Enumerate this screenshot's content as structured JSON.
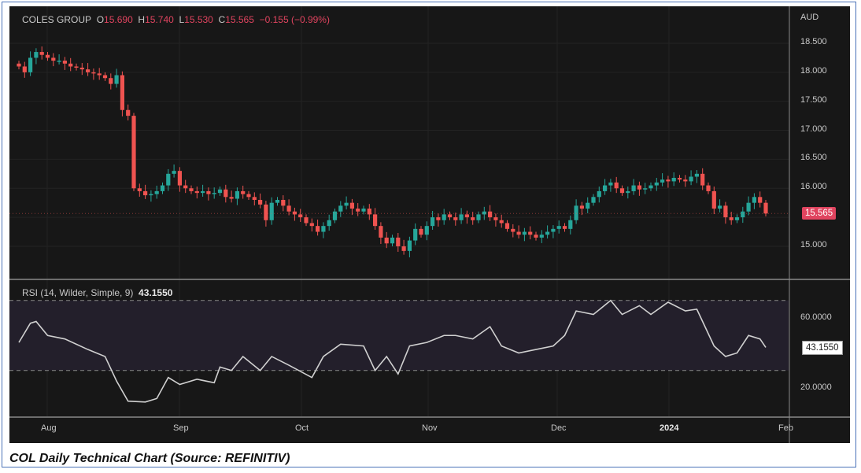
{
  "legend": {
    "name": "COLES GROUP",
    "o_label": "O",
    "o": "15.690",
    "h_label": "H",
    "h": "15.740",
    "l_label": "L",
    "l": "15.530",
    "c_label": "C",
    "c": "15.565",
    "change": "−0.155 (−0.99%)"
  },
  "rsi_legend": {
    "label": "RSI (14, Wilder, Simple, 9)",
    "value": "43.1550"
  },
  "price_axis": {
    "currency": "AUD",
    "ticks": [
      "18.500",
      "18.000",
      "17.500",
      "17.000",
      "16.500",
      "16.000",
      "15.000"
    ],
    "last_price": "15.565"
  },
  "rsi_axis": {
    "ticks": [
      "60.0000",
      "20.0000"
    ],
    "last_value": "43.1550"
  },
  "time_axis": [
    "Aug",
    "Sep",
    "Oct",
    "Nov",
    "Dec",
    "2024",
    "Feb"
  ],
  "caption": "COL Daily Technical Chart (Source: REFINITIV)",
  "colors": {
    "up": "#26a69a",
    "down": "#ef5350",
    "rsi_line": "#d0d0d0",
    "rsi_band": "#231f2b"
  },
  "chart_data": {
    "type": "candlestick",
    "title": "COLES GROUP",
    "ylabel": "AUD",
    "ylim": [
      14.6,
      18.8
    ],
    "open_first": 18.15,
    "closes": [
      18.1,
      18.0,
      18.25,
      18.35,
      18.3,
      18.25,
      18.2,
      18.2,
      18.15,
      18.1,
      18.08,
      18.05,
      18.0,
      17.98,
      17.95,
      17.9,
      17.8,
      17.95,
      17.35,
      17.25,
      16.0,
      15.95,
      15.88,
      15.9,
      15.95,
      16.05,
      16.25,
      16.3,
      16.05,
      16.0,
      15.95,
      15.92,
      15.95,
      15.9,
      15.92,
      15.98,
      15.85,
      15.82,
      15.95,
      15.9,
      15.85,
      15.8,
      15.72,
      15.45,
      15.75,
      15.8,
      15.7,
      15.6,
      15.55,
      15.5,
      15.4,
      15.35,
      15.25,
      15.35,
      15.45,
      15.6,
      15.7,
      15.75,
      15.65,
      15.6,
      15.65,
      15.55,
      15.35,
      15.15,
      15.05,
      15.15,
      15.0,
      14.92,
      15.1,
      15.3,
      15.2,
      15.35,
      15.5,
      15.45,
      15.55,
      15.5,
      15.45,
      15.55,
      15.5,
      15.45,
      15.55,
      15.6,
      15.5,
      15.45,
      15.4,
      15.3,
      15.25,
      15.2,
      15.25,
      15.2,
      15.15,
      15.2,
      15.25,
      15.3,
      15.35,
      15.3,
      15.45,
      15.7,
      15.65,
      15.75,
      15.85,
      15.95,
      16.05,
      16.1,
      16.0,
      15.92,
      15.95,
      16.05,
      15.98,
      16.0,
      16.05,
      16.1,
      16.15,
      16.12,
      16.18,
      16.15,
      16.12,
      16.2,
      16.25,
      16.05,
      15.95,
      15.65,
      15.7,
      15.5,
      15.45,
      15.5,
      15.6,
      15.75,
      15.85,
      15.75,
      15.565
    ],
    "rsi": {
      "name": "RSI (14, Wilder, Simple, 9)",
      "ylim": [
        5,
        78
      ],
      "overbought": 70,
      "oversold": 30,
      "points": [
        [
          0,
          46
        ],
        [
          2,
          57
        ],
        [
          3,
          58
        ],
        [
          5,
          50
        ],
        [
          8,
          48
        ],
        [
          10,
          45
        ],
        [
          12,
          42
        ],
        [
          15,
          38
        ],
        [
          17,
          24
        ],
        [
          19,
          12.5
        ],
        [
          22,
          12
        ],
        [
          24,
          14
        ],
        [
          26,
          26
        ],
        [
          28,
          22
        ],
        [
          31,
          25
        ],
        [
          34,
          23
        ],
        [
          35,
          32
        ],
        [
          37,
          30
        ],
        [
          39,
          38
        ],
        [
          42,
          30
        ],
        [
          44,
          38
        ],
        [
          47,
          33
        ],
        [
          51,
          26
        ],
        [
          53,
          38
        ],
        [
          56,
          45
        ],
        [
          60,
          44
        ],
        [
          62,
          30
        ],
        [
          64,
          38
        ],
        [
          66,
          28
        ],
        [
          68,
          44
        ],
        [
          71,
          46
        ],
        [
          74,
          50
        ],
        [
          76,
          50
        ],
        [
          79,
          48
        ],
        [
          82,
          55
        ],
        [
          84,
          44
        ],
        [
          87,
          40
        ],
        [
          90,
          42
        ],
        [
          93,
          44
        ],
        [
          95,
          50
        ],
        [
          97,
          64
        ],
        [
          100,
          62
        ],
        [
          103,
          70
        ],
        [
          105,
          62
        ],
        [
          108,
          67
        ],
        [
          110,
          62
        ],
        [
          113,
          69
        ],
        [
          116,
          64
        ],
        [
          118,
          65
        ],
        [
          121,
          44
        ],
        [
          123,
          38
        ],
        [
          125,
          40
        ],
        [
          127,
          50
        ],
        [
          129,
          48
        ],
        [
          130,
          43.155
        ]
      ]
    }
  }
}
